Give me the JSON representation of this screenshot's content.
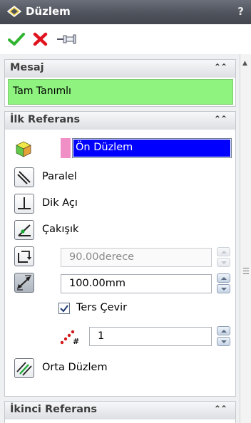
{
  "window": {
    "title": "Düzlem",
    "help_label": "?"
  },
  "toolbar": {
    "ok_icon": "checkmark-icon",
    "cancel_icon": "x-icon",
    "pin_icon": "pushpin-icon",
    "ok_color": "#2fb52f",
    "cancel_color": "#e0141e"
  },
  "message_section": {
    "title": "Mesaj",
    "collapse_glyph": "⌃⌃",
    "message": "Tam Tanımlı",
    "message_color": "#8ef37f"
  },
  "first_reference": {
    "title": "İlk Referans",
    "collapse_glyph": "⌃⌃",
    "selection": "Ön Düzlem",
    "selection_color": "#0000ff",
    "options": [
      {
        "label": "Paralel",
        "icon": "parallel-icon"
      },
      {
        "label": "Dik Açı",
        "icon": "perpendicular-icon"
      },
      {
        "label": "Çakışık",
        "icon": "coincident-icon"
      }
    ],
    "angle_value": "90.00derece",
    "distance_value": "100.00mm",
    "flip_label": "Ters Çevir",
    "flip_checked": true,
    "count_value": "1",
    "mid_plane_label": "Orta Düzlem"
  },
  "second_reference": {
    "title": "İkinci Referans",
    "collapse_glyph": "⌃⌃"
  }
}
